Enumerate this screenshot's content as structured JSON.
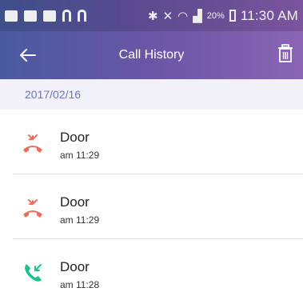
{
  "status_bar": {
    "battery": "20%",
    "time": "11:30 AM"
  },
  "header": {
    "title": "Call History"
  },
  "date_label": "2017/02/16",
  "calls": [
    {
      "name": "Door",
      "time": "am 11:29",
      "type": "missed",
      "icon": "missed-call-icon",
      "color": "#f06a5c"
    },
    {
      "name": "Door",
      "time": "am 11:29",
      "type": "missed",
      "icon": "missed-call-icon",
      "color": "#f06a5c"
    },
    {
      "name": "Door",
      "time": "am 11:28",
      "type": "received",
      "icon": "incoming-call-icon",
      "color": "#1ec08e"
    }
  ],
  "colors": {
    "accent": "#6a56a6",
    "date_text": "#6a78b6",
    "missed": "#f06a5c",
    "received": "#1ec08e"
  }
}
